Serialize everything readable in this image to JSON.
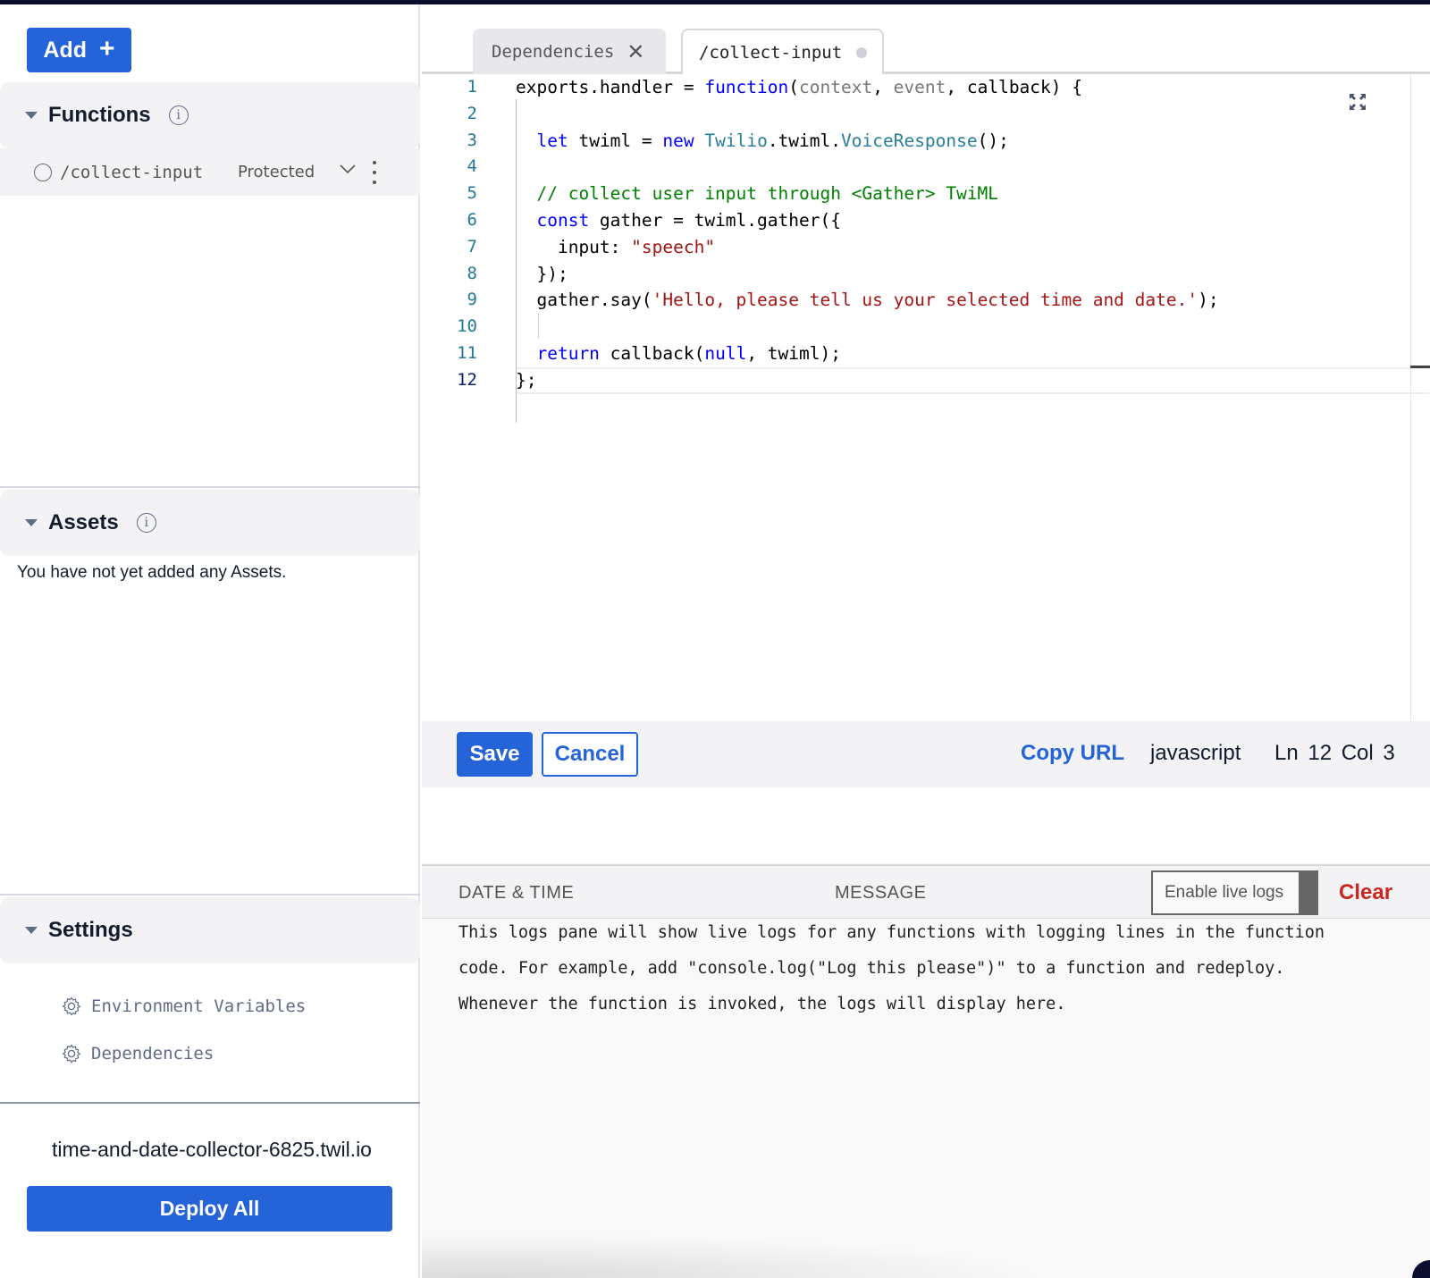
{
  "sidebar": {
    "add_label": "Add",
    "add_icon": "plus-icon",
    "functions": {
      "title": "Functions",
      "items": [
        {
          "path": "/collect-input",
          "visibility": "Protected"
        }
      ]
    },
    "assets": {
      "title": "Assets",
      "empty_message": "You have not yet added any Assets."
    },
    "settings": {
      "title": "Settings",
      "items": [
        {
          "label": "Environment Variables",
          "icon": "gear-icon"
        },
        {
          "label": "Dependencies",
          "icon": "gear-icon"
        }
      ]
    },
    "domain": "time-and-date-collector-6825.twil.io",
    "deploy_label": "Deploy All"
  },
  "tabs": [
    {
      "label": "Dependencies",
      "state": "closable"
    },
    {
      "label": "/collect-input",
      "state": "active-unsaved"
    }
  ],
  "editor": {
    "line_numbers": [
      "1",
      "2",
      "3",
      "4",
      "5",
      "6",
      "7",
      "8",
      "9",
      "10",
      "11",
      "12"
    ],
    "lines": [
      [
        {
          "t": "exports.handler = ",
          "c": ""
        },
        {
          "t": "function",
          "c": "kw"
        },
        {
          "t": "(",
          "c": ""
        },
        {
          "t": "context",
          "c": "dim"
        },
        {
          "t": ", ",
          "c": ""
        },
        {
          "t": "event",
          "c": "dim"
        },
        {
          "t": ", callback) {",
          "c": ""
        }
      ],
      [],
      [
        {
          "t": "  ",
          "c": ""
        },
        {
          "t": "let",
          "c": "kw"
        },
        {
          "t": " twiml = ",
          "c": ""
        },
        {
          "t": "new",
          "c": "kw"
        },
        {
          "t": " ",
          "c": ""
        },
        {
          "t": "Twilio",
          "c": "ty"
        },
        {
          "t": ".twiml.",
          "c": ""
        },
        {
          "t": "VoiceResponse",
          "c": "ty"
        },
        {
          "t": "();",
          "c": ""
        }
      ],
      [],
      [
        {
          "t": "  // collect user input through <Gather> TwiML",
          "c": "cm"
        }
      ],
      [
        {
          "t": "  ",
          "c": ""
        },
        {
          "t": "const",
          "c": "kw"
        },
        {
          "t": " gather = twiml.gather({",
          "c": ""
        }
      ],
      [
        {
          "t": "    input: ",
          "c": ""
        },
        {
          "t": "\"speech\"",
          "c": "st"
        }
      ],
      [
        {
          "t": "  });",
          "c": ""
        }
      ],
      [
        {
          "t": "  gather.say(",
          "c": ""
        },
        {
          "t": "'Hello, please tell us your selected time and date.'",
          "c": "st"
        },
        {
          "t": ");",
          "c": ""
        }
      ],
      [],
      [
        {
          "t": "  ",
          "c": ""
        },
        {
          "t": "return",
          "c": "kw"
        },
        {
          "t": " callback(",
          "c": ""
        },
        {
          "t": "null",
          "c": "kw"
        },
        {
          "t": ", twiml);",
          "c": ""
        }
      ],
      [
        {
          "t": "};",
          "c": ""
        }
      ]
    ],
    "save_label": "Save",
    "cancel_label": "Cancel",
    "copy_url_label": "Copy URL",
    "language": "javascript",
    "cursor_position": "Ln 12  Col 3"
  },
  "logs": {
    "col_date": "DATE & TIME",
    "col_message": "MESSAGE",
    "live_toggle_label": "Enable live logs",
    "live_enabled": false,
    "clear_label": "Clear",
    "body_lines": [
      "This logs pane will show live logs for any functions with logging lines in the function",
      "code. For example, add \"console.log(\"Log this please\")\" to a function and redeploy.",
      "Whenever the function is invoked, the logs will display here."
    ]
  },
  "colors": {
    "primary": "#2563d9",
    "danger": "#c8261e",
    "keyword": "#0000ff",
    "type": "#267f99",
    "comment": "#008000",
    "string": "#a31515",
    "line_number": "#237893"
  }
}
